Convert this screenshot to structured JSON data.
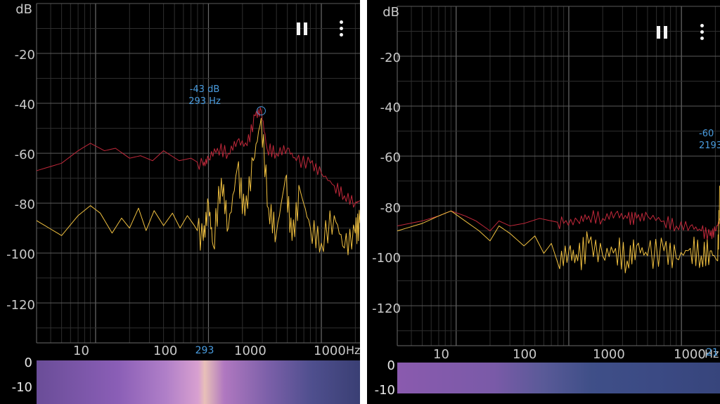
{
  "panels": [
    {
      "id": "left",
      "y_unit": "dB",
      "y_ticks": [
        "-20",
        "-40",
        "-60",
        "-80",
        "-100",
        "-120"
      ],
      "x_ticks": [
        "10",
        "100",
        "1000",
        "1000"
      ],
      "x_unit": "Hz",
      "peak_db": "-43 dB",
      "peak_hz": "293 Hz",
      "cursor_freq": "293",
      "spec_ticks": [
        "0",
        "-10"
      ],
      "icons": [
        "pause-icon",
        "more-vert-icon"
      ]
    },
    {
      "id": "right",
      "y_unit": "dB",
      "y_ticks": [
        "-20",
        "-40",
        "-60",
        "-80",
        "-100",
        "-120"
      ],
      "x_ticks": [
        "10",
        "100",
        "1000",
        "1000"
      ],
      "x_unit": "Hz",
      "peak_db": "-60",
      "peak_hz": "2193",
      "cursor_freq": "21",
      "spec_ticks": [
        "0",
        "-10"
      ],
      "icons": [
        "pause-icon",
        "more-vert-icon"
      ]
    }
  ],
  "colors": {
    "background": "#000000",
    "grid": "#3a3a3a",
    "peak_trace": "#c0283a",
    "live_trace": "#f0c040",
    "label": "#c9c9c9",
    "marker": "#4a9de0"
  },
  "chart_data": [
    {
      "type": "line",
      "xscale": "log",
      "xlabel": "Hz",
      "ylabel": "dB",
      "xlim": [
        3,
        2200
      ],
      "ylim": [
        -136,
        0
      ],
      "series": [
        {
          "points": [
            [
              3,
              -67
            ],
            [
              5,
              -64
            ],
            [
              7,
              -59
            ],
            [
              9,
              -56
            ],
            [
              12,
              -59
            ],
            [
              15,
              -58
            ],
            [
              20,
              -62
            ],
            [
              25,
              -61
            ],
            [
              32,
              -63
            ],
            [
              40,
              -59
            ],
            [
              55,
              -63
            ],
            [
              70,
              -62
            ],
            [
              90,
              -65
            ],
            [
              100,
              -62
            ],
            [
              120,
              -58
            ],
            [
              150,
              -60
            ],
            [
              180,
              -55
            ],
            [
              220,
              -57
            ],
            [
              260,
              -45
            ],
            [
              293,
              -43
            ],
            [
              330,
              -58
            ],
            [
              400,
              -60
            ],
            [
              500,
              -58
            ],
            [
              600,
              -63
            ],
            [
              800,
              -64
            ],
            [
              1000,
              -68
            ],
            [
              1300,
              -73
            ],
            [
              1600,
              -77
            ],
            [
              2000,
              -80
            ],
            [
              2200,
              -79
            ]
          ]
        },
        {
          "points": [
            [
              3,
              -87
            ],
            [
              5,
              -93
            ],
            [
              7,
              -85
            ],
            [
              9,
              -81
            ],
            [
              11,
              -84
            ],
            [
              14,
              -92
            ],
            [
              17,
              -86
            ],
            [
              20,
              -90
            ],
            [
              24,
              -82
            ],
            [
              28,
              -91
            ],
            [
              33,
              -83
            ],
            [
              40,
              -89
            ],
            [
              48,
              -84
            ],
            [
              56,
              -90
            ],
            [
              65,
              -85
            ],
            [
              75,
              -89
            ],
            [
              90,
              -95
            ],
            [
              100,
              -80
            ],
            [
              110,
              -97
            ],
            [
              130,
              -70
            ],
            [
              150,
              -90
            ],
            [
              180,
              -66
            ],
            [
              210,
              -85
            ],
            [
              250,
              -63
            ],
            [
              293,
              -46
            ],
            [
              340,
              -82
            ],
            [
              400,
              -92
            ],
            [
              480,
              -70
            ],
            [
              550,
              -95
            ],
            [
              650,
              -75
            ],
            [
              800,
              -90
            ],
            [
              1000,
              -96
            ],
            [
              1300,
              -85
            ],
            [
              1600,
              -98
            ],
            [
              2000,
              -92
            ],
            [
              2200,
              -88
            ]
          ]
        }
      ]
    },
    {
      "type": "line",
      "xscale": "log",
      "xlabel": "Hz",
      "ylabel": "dB",
      "xlim": [
        3,
        2200
      ],
      "ylim": [
        -136,
        0
      ],
      "series": [
        {
          "points": [
            [
              3,
              -88
            ],
            [
              5,
              -86
            ],
            [
              7,
              -84
            ],
            [
              9,
              -82
            ],
            [
              12,
              -84
            ],
            [
              15,
              -86
            ],
            [
              20,
              -90
            ],
            [
              24,
              -86
            ],
            [
              30,
              -88
            ],
            [
              40,
              -87
            ],
            [
              55,
              -85
            ],
            [
              70,
              -86
            ],
            [
              90,
              -87
            ],
            [
              120,
              -86
            ],
            [
              150,
              -84
            ],
            [
              200,
              -85
            ],
            [
              260,
              -83
            ],
            [
              330,
              -85
            ],
            [
              400,
              -85
            ],
            [
              500,
              -84
            ],
            [
              700,
              -86
            ],
            [
              900,
              -88
            ],
            [
              1200,
              -88
            ],
            [
              1500,
              -90
            ],
            [
              1800,
              -92
            ],
            [
              2000,
              -90
            ],
            [
              2200,
              -85
            ]
          ]
        },
        {
          "points": [
            [
              3,
              -90
            ],
            [
              5,
              -87
            ],
            [
              7,
              -84
            ],
            [
              9,
              -82
            ],
            [
              12,
              -86
            ],
            [
              16,
              -90
            ],
            [
              20,
              -94
            ],
            [
              24,
              -88
            ],
            [
              30,
              -91
            ],
            [
              40,
              -96
            ],
            [
              50,
              -92
            ],
            [
              60,
              -99
            ],
            [
              70,
              -95
            ],
            [
              80,
              -103
            ],
            [
              100,
              -98
            ],
            [
              120,
              -102
            ],
            [
              150,
              -95
            ],
            [
              200,
              -100
            ],
            [
              260,
              -97
            ],
            [
              330,
              -102
            ],
            [
              400,
              -96
            ],
            [
              500,
              -100
            ],
            [
              700,
              -98
            ],
            [
              900,
              -101
            ],
            [
              1200,
              -97
            ],
            [
              1500,
              -100
            ],
            [
              1800,
              -98
            ],
            [
              2100,
              -102
            ],
            [
              2200,
              -72
            ]
          ]
        }
      ]
    }
  ]
}
